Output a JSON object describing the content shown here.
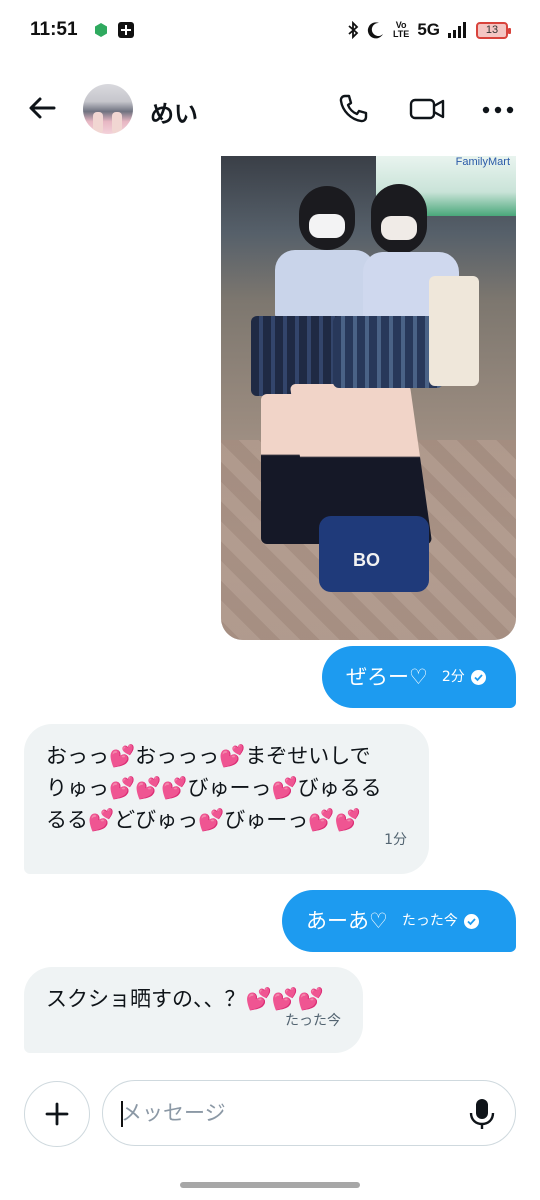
{
  "status_bar": {
    "time": "11:51",
    "network": "5G",
    "volte": "Vo\nLTE",
    "battery": "13"
  },
  "header": {
    "contact_name": "めい"
  },
  "photo": {
    "sign_text": "FamilyMart",
    "bag_text": "BO"
  },
  "messages": [
    {
      "direction": "out",
      "text": "ぜろー♡",
      "time": "2分"
    },
    {
      "direction": "in",
      "text": "おっっ💕おっっっ💕まぞせいしで\nりゅっ💕💕💕びゅーっ💕びゅるる\nるる💕どびゅっ💕びゅーっ💕💕",
      "time": "1分"
    },
    {
      "direction": "out",
      "text": "あーあ♡",
      "time": "たった今"
    },
    {
      "direction": "in",
      "text": "スクショ晒すの、、？💕💕💕",
      "time": "たった今"
    }
  ],
  "composer": {
    "placeholder": "メッセージ"
  },
  "colors": {
    "accent": "#1d9bf0",
    "incoming_bubble": "#eff3f4",
    "heart": "#f04fa0"
  },
  "icons": [
    "back-arrow-icon",
    "phone-icon",
    "video-icon",
    "more-icon",
    "plus-icon",
    "mic-icon",
    "check-icon"
  ]
}
